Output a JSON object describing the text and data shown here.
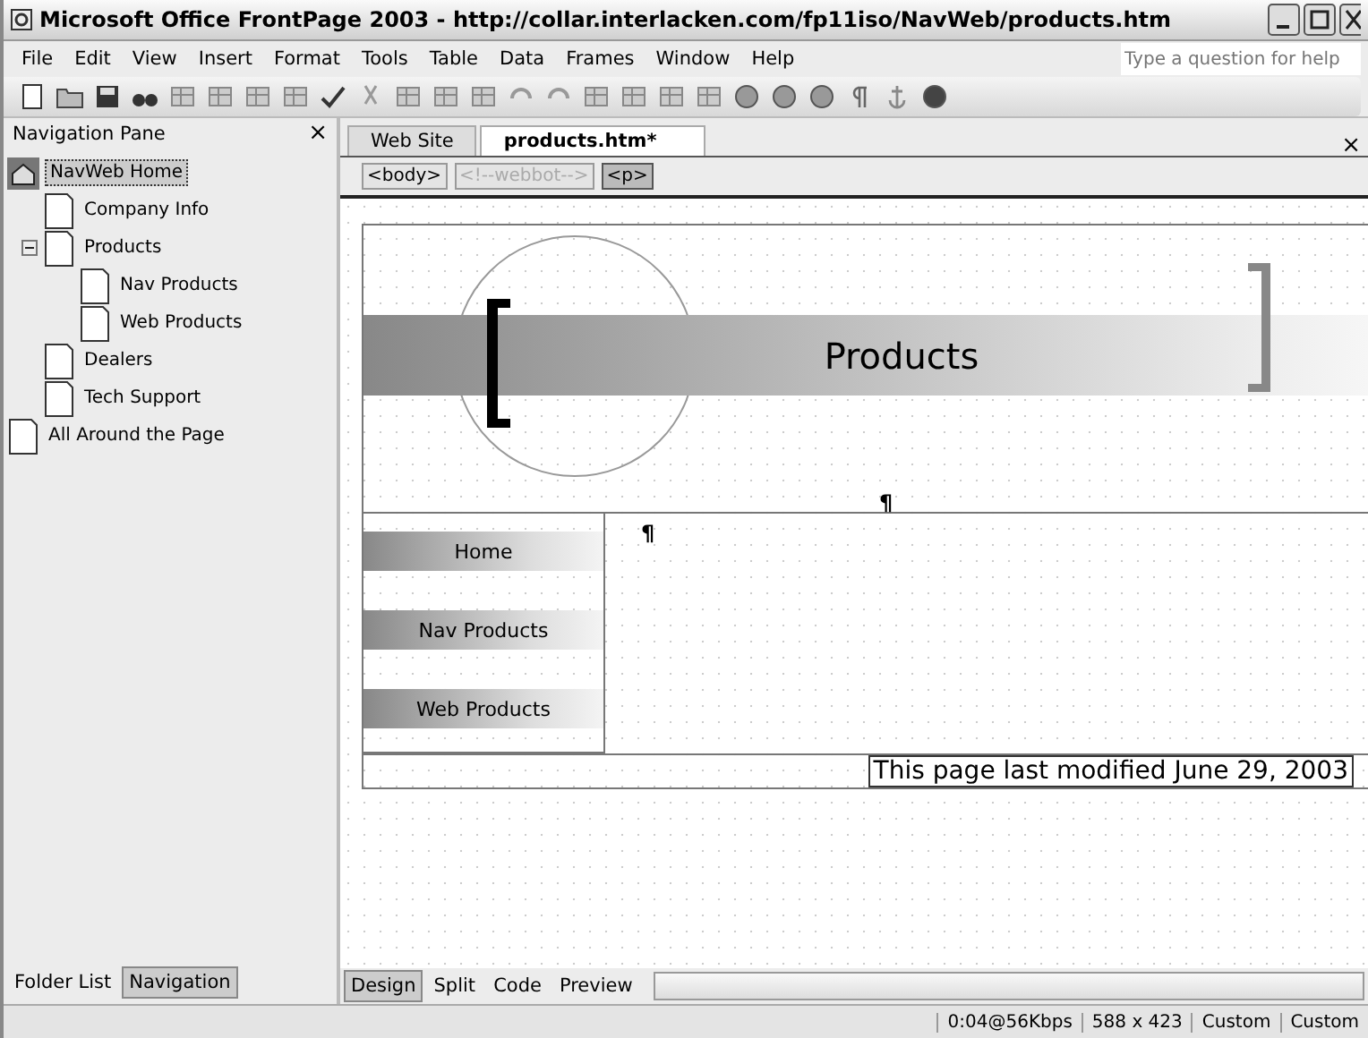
{
  "window": {
    "title": "Microsoft Office FrontPage 2003 - http://collar.interlacken.com/fp11iso/NavWeb/products.htm"
  },
  "menu": [
    "File",
    "Edit",
    "View",
    "Insert",
    "Format",
    "Tools",
    "Table",
    "Data",
    "Frames",
    "Window",
    "Help"
  ],
  "help_box": {
    "placeholder": "Type a question for help"
  },
  "navigation_pane": {
    "title": "Navigation Pane",
    "close": "×",
    "items": [
      {
        "label": "NavWeb Home",
        "kind": "home",
        "selected": true,
        "children": [
          {
            "label": "Company Info",
            "kind": "page",
            "selected": false
          },
          {
            "label": "Products",
            "kind": "page",
            "selected": false,
            "expanded": true,
            "children": [
              {
                "label": "Nav Products",
                "kind": "page",
                "selected": false
              },
              {
                "label": "Web Products",
                "kind": "page",
                "selected": false
              }
            ]
          },
          {
            "label": "Dealers",
            "kind": "page",
            "selected": false
          },
          {
            "label": "Tech Support",
            "kind": "page",
            "selected": false
          }
        ]
      },
      {
        "label": "All Around the Page",
        "kind": "page",
        "selected": false
      }
    ],
    "bottom_tabs": [
      {
        "label": "Folder List",
        "selected": false
      },
      {
        "label": "Navigation",
        "selected": true
      }
    ]
  },
  "editor": {
    "tabs": [
      {
        "label": "Web Site",
        "selected": false
      },
      {
        "label": "products.htm*",
        "selected": true
      }
    ],
    "close": "×",
    "tags": [
      {
        "label": "<body>",
        "disabled": false,
        "selected": false
      },
      {
        "label": "<!--webbot-->",
        "disabled": true,
        "selected": false
      },
      {
        "label": "<p>",
        "disabled": false,
        "selected": true
      }
    ],
    "page": {
      "banner": "Products",
      "pilcrow_top": "¶",
      "pilcrow_body": "¶",
      "nav_buttons": [
        "Home",
        "Nav Products",
        "Web Products"
      ],
      "footer": "This page last modified June 29, 2003"
    },
    "view_tabs": [
      {
        "label": "Design",
        "selected": true
      },
      {
        "label": "Split",
        "selected": false
      },
      {
        "label": "Code",
        "selected": false
      },
      {
        "label": "Preview",
        "selected": false
      }
    ]
  },
  "status_bar": [
    "0:04@56Kbps",
    "588 x 423",
    "Custom",
    "Custom"
  ]
}
